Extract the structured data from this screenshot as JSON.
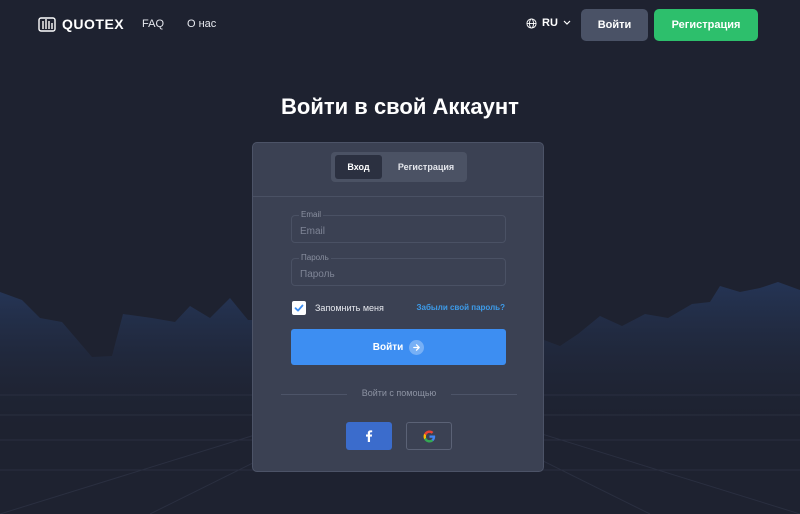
{
  "header": {
    "logo_text": "QUOTEX",
    "nav": [
      {
        "label": "FAQ"
      },
      {
        "label": "О нас"
      }
    ],
    "language": "RU",
    "login_label": "Войти",
    "register_label": "Регистрация"
  },
  "page_title": "Войти в свой Аккаунт",
  "form": {
    "tabs": [
      {
        "label": "Вход",
        "active": true
      },
      {
        "label": "Регистрация",
        "active": false
      }
    ],
    "email": {
      "label": "Email",
      "placeholder": "Email",
      "value": ""
    },
    "password": {
      "label": "Пароль",
      "placeholder": "Пароль",
      "value": ""
    },
    "remember_label": "Запомнить меня",
    "remember_checked": true,
    "forgot_label": "Забыли свой пароль?",
    "submit_label": "Войти",
    "social_label": "Войти с помощью"
  },
  "icons": {
    "logo": "quotex-logo-icon",
    "globe": "globe-icon",
    "chevron": "chevron-down-icon",
    "check": "check-icon",
    "arrow": "arrow-right-icon",
    "facebook": "facebook-icon",
    "google": "google-icon"
  },
  "colors": {
    "background": "#1e2230",
    "card": "#3b4153",
    "accent_blue": "#3d8ef2",
    "accent_green": "#2dbf6c",
    "link": "#3d9be9",
    "facebook": "#3b6ccc"
  }
}
